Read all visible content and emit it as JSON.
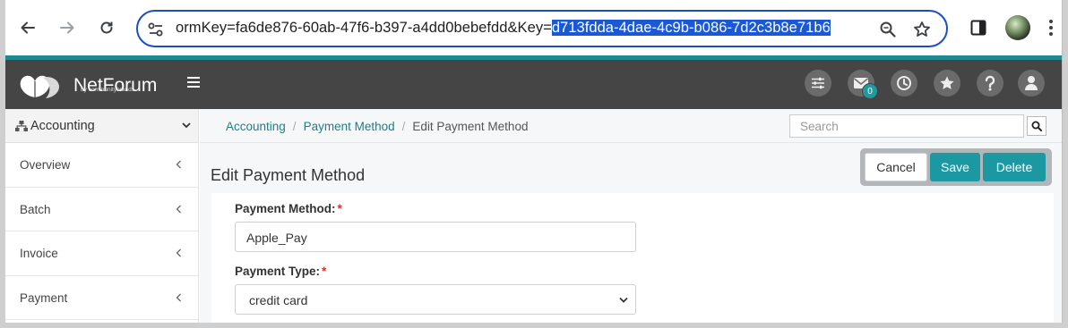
{
  "browser": {
    "url_prefix": "ormKey=fa6de876-60ab-47f6-b397-a4dd0bebefdd&Key=",
    "url_selected": "d713fdda-4dae-4c9b-b086-7d2c3b8e71b6"
  },
  "header": {
    "logo_text": "NetForum",
    "logo_sub": "by communitybrands",
    "mail_count": "0",
    "icons": [
      "sliders-icon",
      "mail-icon",
      "history-icon",
      "star-icon",
      "help-icon",
      "user-icon"
    ]
  },
  "sidebar": {
    "module": "Accounting",
    "items": [
      {
        "label": "Overview"
      },
      {
        "label": "Batch"
      },
      {
        "label": "Invoice"
      },
      {
        "label": "Payment"
      }
    ]
  },
  "breadcrumb": {
    "items": [
      "Accounting",
      "Payment Method"
    ],
    "current": "Edit Payment Method"
  },
  "search": {
    "placeholder": "Search"
  },
  "page": {
    "title": "Edit Payment Method",
    "cancel_label": "Cancel",
    "save_label": "Save",
    "delete_label": "Delete"
  },
  "form": {
    "payment_method_label": "Payment Method:",
    "payment_method_value": "Apple_Pay",
    "payment_type_label": "Payment Type:",
    "payment_type_value": "credit card",
    "required_mark": "*"
  },
  "colors": {
    "teal": "#1c98a3",
    "header_bg": "#454545",
    "url_selection": "#1a58d6",
    "required": "#d9302c"
  }
}
